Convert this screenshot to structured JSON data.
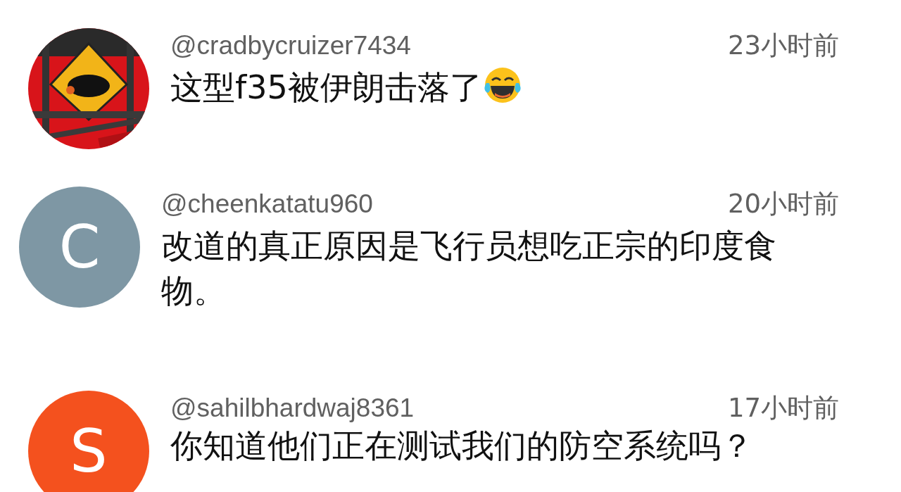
{
  "comments": [
    {
      "author": "@cradbycruizer7434",
      "time": "23小时前",
      "text": "这型f35被伊朗击落了",
      "emoji": true
    },
    {
      "avatar": {
        "kind": "letter",
        "letter": "C",
        "color": "#7e97a4"
      },
      "author": "@cheenkatatu960",
      "time": "20小时前",
      "text": "改道的真正原因是飞行员想吃正宗的印度食物。",
      "emoji": false
    },
    {
      "avatar": {
        "kind": "letter",
        "letter": "S",
        "color": "#f4511e"
      },
      "author": "@sahilbhardwaj8361",
      "time": "17小时前",
      "text": "你知道他们正在测试我们的防空系统吗？",
      "emoji": false
    }
  ]
}
